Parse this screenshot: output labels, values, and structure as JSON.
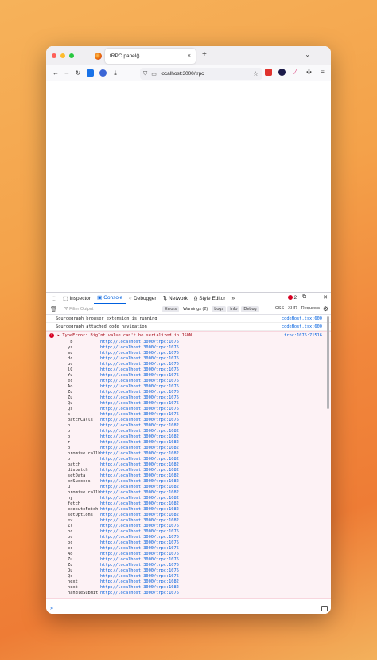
{
  "browser": {
    "tab_title": "tRPC.panel()",
    "tab_close": "×",
    "new_tab": "+",
    "tabs_menu": "⌄",
    "url": "localhost:3000/trpc"
  },
  "devtools": {
    "tabs": [
      {
        "label": "Inspector",
        "icon": "⬚"
      },
      {
        "label": "Console",
        "icon": "▣"
      },
      {
        "label": "Debugger",
        "icon": "◐"
      },
      {
        "label": "Network",
        "icon": "⇅"
      },
      {
        "label": "Style Editor",
        "icon": "{}"
      }
    ],
    "overflow": "»",
    "error_count": "2",
    "filter_placeholder": "Filter Output",
    "levels": [
      "Errors",
      "Warnings (2)",
      "Logs",
      "Info",
      "Debug"
    ],
    "request_filters": [
      "CSS",
      "XHR",
      "Requests"
    ],
    "prompt": "»"
  },
  "console": {
    "messages": [
      {
        "text": "Sourcegraph browser extension is running",
        "source": "codeHost.tsx:600"
      },
      {
        "text": "Sourcegraph attached code navigation",
        "source": "codeHost.tsx:600"
      }
    ],
    "error": {
      "text": "▸ TypeError: BigInt value can't be serialized in JSON",
      "source": "trpc:1076:71516",
      "frames": [
        {
          "fn": "_b",
          "loc": "http://localhost:3000/trpc:1076"
        },
        {
          "fn": "ys",
          "loc": "http://localhost:3000/trpc:1076"
        },
        {
          "fn": "mu",
          "loc": "http://localhost:3000/trpc:1076"
        },
        {
          "fn": "dc",
          "loc": "http://localhost:3000/trpc:1076"
        },
        {
          "fn": "uc",
          "loc": "http://localhost:3000/trpc:1076"
        },
        {
          "fn": "lC",
          "loc": "http://localhost:3000/trpc:1076"
        },
        {
          "fn": "Yu",
          "loc": "http://localhost:3000/trpc:1076"
        },
        {
          "fn": "ec",
          "loc": "http://localhost:3000/trpc:1076"
        },
        {
          "fn": "Ao",
          "loc": "http://localhost:3000/trpc:1076"
        },
        {
          "fn": "Zu",
          "loc": "http://localhost:3000/trpc:1076"
        },
        {
          "fn": "Zu",
          "loc": "http://localhost:3000/trpc:1076"
        },
        {
          "fn": "Qu",
          "loc": "http://localhost:3000/trpc:1076"
        },
        {
          "fn": "Qs",
          "loc": "http://localhost:3000/trpc:1076"
        },
        {
          "fn": "s",
          "loc": "http://localhost:3000/trpc:1076"
        },
        {
          "fn": "batchCalls",
          "loc": "http://localhost:3000/trpc:1076"
        },
        {
          "fn": "n",
          "loc": "http://localhost:3000/trpc:1082"
        },
        {
          "fn": "o",
          "loc": "http://localhost:3000/trpc:1082"
        },
        {
          "fn": "o",
          "loc": "http://localhost:3000/trpc:1082"
        },
        {
          "fn": "r",
          "loc": "http://localhost:3000/trpc:1082"
        },
        {
          "fn": "o",
          "loc": "http://localhost:3000/trpc:1082"
        },
        {
          "fn": "promise callback*On",
          "loc": "http://localhost:3000/trpc:1082"
        },
        {
          "fn": "o",
          "loc": "http://localhost:3000/trpc:1082"
        },
        {
          "fn": "batch",
          "loc": "http://localhost:3000/trpc:1082"
        },
        {
          "fn": "dispatch",
          "loc": "http://localhost:3000/trpc:1082"
        },
        {
          "fn": "setData",
          "loc": "http://localhost:3000/trpc:1082"
        },
        {
          "fn": "onSuccess",
          "loc": "http://localhost:3000/trpc:1082"
        },
        {
          "fn": "u",
          "loc": "http://localhost:3000/trpc:1082"
        },
        {
          "fn": "promise callback*f",
          "loc": "http://localhost:3000/trpc:1082"
        },
        {
          "fn": "ny",
          "loc": "http://localhost:3000/trpc:1082"
        },
        {
          "fn": "fetch",
          "loc": "http://localhost:3000/trpc:1082"
        },
        {
          "fn": "executeFetch",
          "loc": "http://localhost:3000/trpc:1082"
        },
        {
          "fn": "setOptions",
          "loc": "http://localhost:3000/trpc:1082"
        },
        {
          "fn": "ev",
          "loc": "http://localhost:3000/trpc:1082"
        },
        {
          "fn": "Zl",
          "loc": "http://localhost:3000/trpc:1076"
        },
        {
          "fn": "hc",
          "loc": "http://localhost:3000/trpc:1076"
        },
        {
          "fn": "pc",
          "loc": "http://localhost:3000/trpc:1076"
        },
        {
          "fn": "pc",
          "loc": "http://localhost:3000/trpc:1076"
        },
        {
          "fn": "ec",
          "loc": "http://localhost:3000/trpc:1076"
        },
        {
          "fn": "Ao",
          "loc": "http://localhost:3000/trpc:1076"
        },
        {
          "fn": "Zu",
          "loc": "http://localhost:3000/trpc:1076"
        },
        {
          "fn": "Zu",
          "loc": "http://localhost:3000/trpc:1076"
        },
        {
          "fn": "Qu",
          "loc": "http://localhost:3000/trpc:1076"
        },
        {
          "fn": "Qs",
          "loc": "http://localhost:3000/trpc:1076"
        },
        {
          "fn": "next",
          "loc": "http://localhost:3000/trpc:1082"
        },
        {
          "fn": "next",
          "loc": "http://localhost:3000/trpc:1082"
        },
        {
          "fn": "handleSubmit",
          "loc": "http://localhost:3000/trpc:1076"
        }
      ]
    }
  },
  "colors": {
    "accent": "#0060df",
    "error": "#d70022",
    "error_bg": "#fdf2f5"
  }
}
